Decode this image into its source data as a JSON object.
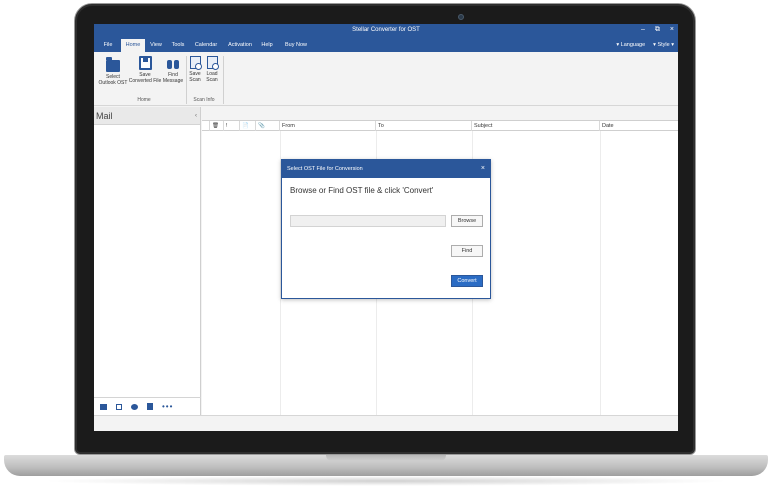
{
  "app": {
    "title": "Stellar Converter for OST"
  },
  "window_controls": {
    "minimize": "–",
    "maximize": "⧉",
    "close": "×"
  },
  "menu": {
    "tabs": [
      "File",
      "Home",
      "View",
      "Tools",
      "Calendar",
      "Activation",
      "Help",
      "Buy Now"
    ],
    "active": "Home",
    "language": "Language",
    "style": "Style"
  },
  "ribbon": {
    "select_outlook_ost": "Select\nOutlook OST",
    "save_converted_file": "Save\nConverted File",
    "find_message": "Find\nMessage",
    "home_group": "Home",
    "save_scan": "Save\nScan",
    "load_scan": "Load\nScan",
    "scan_info_group": "Scan Info"
  },
  "sidebar": {
    "title": "Mail",
    "collapse": "‹"
  },
  "grid": {
    "columns": [
      "🗑",
      "!",
      "📄",
      "📎",
      "From",
      "To",
      "Subject",
      "Date"
    ]
  },
  "footer_icons": [
    "mail-icon",
    "calendar-icon",
    "contacts-icon",
    "tasks-icon",
    "more-icon"
  ],
  "dialog": {
    "title": "Select OST File for Conversion",
    "close": "×",
    "heading": "Browse or Find OST file & click 'Convert'",
    "file_path_value": "",
    "browse": "Browse",
    "find": "Find",
    "convert": "Convert"
  }
}
